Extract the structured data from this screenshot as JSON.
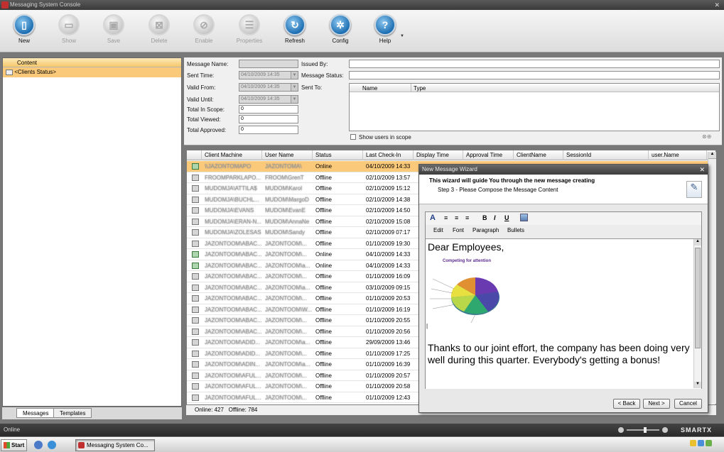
{
  "window": {
    "title": "Messaging System Console"
  },
  "toolbar": [
    {
      "label": "New",
      "icon": "new-icon",
      "enabled": true
    },
    {
      "label": "Show",
      "icon": "show-icon",
      "enabled": false
    },
    {
      "label": "Save",
      "icon": "save-icon",
      "enabled": false
    },
    {
      "label": "Delete",
      "icon": "delete-icon",
      "enabled": false
    },
    {
      "label": "Enable",
      "icon": "enable-icon",
      "enabled": false
    },
    {
      "label": "Properties",
      "icon": "properties-icon",
      "enabled": false
    },
    {
      "label": "Refresh",
      "icon": "refresh-icon",
      "enabled": true
    },
    {
      "label": "Config",
      "icon": "config-icon",
      "enabled": true
    },
    {
      "label": "Help",
      "icon": "help-icon",
      "enabled": true
    }
  ],
  "tree": {
    "header": "Content",
    "item": "<Clients Status>"
  },
  "lefttabs": {
    "messages": "Messages",
    "templates": "Templates"
  },
  "details": {
    "message_name_label": "Message Name:",
    "sent_time_label": "Sent Time:",
    "sent_time_value": "04/10/2009 14:35",
    "valid_from_label": "Valid From:",
    "valid_from_value": "04/10/2009 14:35",
    "valid_until_label": "Valid Until:",
    "valid_until_value": "04/10/2009 14:35",
    "total_in_scope_label": "Total In Scope:",
    "total_in_scope_value": "0",
    "total_viewed_label": "Total Viewed:",
    "total_viewed_value": "0",
    "total_approved_label": "Total Approved:",
    "total_approved_value": "0",
    "issued_by_label": "Issued By:",
    "message_status_label": "Message Status:",
    "sent_to_label": "Sent To:",
    "sent_to_columns": {
      "name": "Name",
      "type": "Type"
    },
    "show_users_label": "Show users in scope"
  },
  "grid": {
    "columns": [
      "Client Machine",
      "User Name",
      "Status",
      "Last Check-In",
      "Display Time",
      "Approval Time",
      "ClientName",
      "SessionId",
      "user.Name"
    ],
    "rows": [
      {
        "machine": "\\\\JAZONTOMAPO",
        "user": "JAZONTOMA\\",
        "status": "Online",
        "checkin": "04/10/2009 14:33"
      },
      {
        "machine": "FROOMPARKLAPO...",
        "user": "FROOM\\GrenT",
        "status": "Offline",
        "checkin": "02/10/2009 13:57"
      },
      {
        "machine": "MUDOMJA\\ATTILA$",
        "user": "MUDOM\\Karol",
        "status": "Offline",
        "checkin": "02/10/2009 15:12"
      },
      {
        "machine": "MUDOMJA\\BUCHL...",
        "user": "MUDOM\\MargoD",
        "status": "Offline",
        "checkin": "02/10/2009 14:38"
      },
      {
        "machine": "MUDOMJA\\EVANS",
        "user": "MUDOM\\EvanE",
        "status": "Offline",
        "checkin": "02/10/2009 14:50"
      },
      {
        "machine": "MUDOMJA\\ERAN-N...",
        "user": "MUDOM\\AnnaNe",
        "status": "Offline",
        "checkin": "02/10/2009 15:08"
      },
      {
        "machine": "MUDOMJA\\ZOLESAS",
        "user": "MUDOM\\Sandy",
        "status": "Offline",
        "checkin": "02/10/2009 07:17"
      },
      {
        "machine": "JAZONTOOM\\ABAC...",
        "user": "JAZONTOOM\\...",
        "status": "Offline",
        "checkin": "01/10/2009 19:30"
      },
      {
        "machine": "JAZONTOOM\\ABAC...",
        "user": "JAZONTOOM\\...",
        "status": "Online",
        "checkin": "04/10/2009 14:33"
      },
      {
        "machine": "JAZONTOOM\\ABAC...",
        "user": "JAZONTOOM\\a...",
        "status": "Online",
        "checkin": "04/10/2009 14:33"
      },
      {
        "machine": "JAZONTOOM\\ABAC...",
        "user": "JAZONTOOM\\...",
        "status": "Offline",
        "checkin": "01/10/2009 16:09"
      },
      {
        "machine": "JAZONTOOM\\ABAC...",
        "user": "JAZONTOOM\\a...",
        "status": "Offline",
        "checkin": "03/10/2009 09:15"
      },
      {
        "machine": "JAZONTOOM\\ABAC...",
        "user": "JAZONTOOM\\...",
        "status": "Offline",
        "checkin": "01/10/2009 20:53"
      },
      {
        "machine": "JAZONTOOM\\ABAC...",
        "user": "JAZONTOOM\\W...",
        "status": "Offline",
        "checkin": "01/10/2009 16:19"
      },
      {
        "machine": "JAZONTOOM\\ABAC...",
        "user": "JAZONTOOM\\...",
        "status": "Offline",
        "checkin": "01/10/2009 20:55"
      },
      {
        "machine": "JAZONTOOM\\ABAC...",
        "user": "JAZONTOOM\\...",
        "status": "Offline",
        "checkin": "01/10/2009 20:56"
      },
      {
        "machine": "JAZONTOOM\\ADID...",
        "user": "JAZONTOOM\\a...",
        "status": "Offline",
        "checkin": "29/09/2009 13:46"
      },
      {
        "machine": "JAZONTOOM\\ADID...",
        "user": "JAZONTOOM\\...",
        "status": "Offline",
        "checkin": "01/10/2009 17:25"
      },
      {
        "machine": "JAZONTOOM\\ADIN...",
        "user": "JAZONTOOM\\a...",
        "status": "Offline",
        "checkin": "01/10/2009 16:39"
      },
      {
        "machine": "JAZONTOOM\\AFUL...",
        "user": "JAZONTOOM\\...",
        "status": "Offline",
        "checkin": "01/10/2009 20:57"
      },
      {
        "machine": "JAZONTOOM\\AFUL...",
        "user": "JAZONTOOM\\...",
        "status": "Offline",
        "checkin": "01/10/2009 20:58"
      },
      {
        "machine": "JAZONTOOM\\AFUL...",
        "user": "JAZONTOOM\\...",
        "status": "Offline",
        "checkin": "01/10/2009 12:43"
      }
    ],
    "footer": {
      "online": "Online: 427",
      "offline": "Offline: 784"
    }
  },
  "wizard": {
    "title": "New Message Wizard",
    "heading": "This wizard will guide You through the new message creating",
    "step": "Step 3 - Please Compose the Message Content",
    "menu": [
      "Edit",
      "Font",
      "Paragraph",
      "Bullets"
    ],
    "body_greeting": "Dear Employees,",
    "chart_caption": "Competing for attention",
    "body_text": "Thanks to our joint effort, the company has been doing very well during this quarter. Everybody's getting a bonus!",
    "back_label": "< Back",
    "next_label": "Next >",
    "cancel_label": "Cancel"
  },
  "status": {
    "text": "Online",
    "brand": "SMARTX"
  },
  "taskbar": {
    "start": "Start",
    "item": "Messaging System Co..."
  },
  "colors": {
    "selection": "#fbc97a",
    "accent": "#1d6fb3"
  }
}
